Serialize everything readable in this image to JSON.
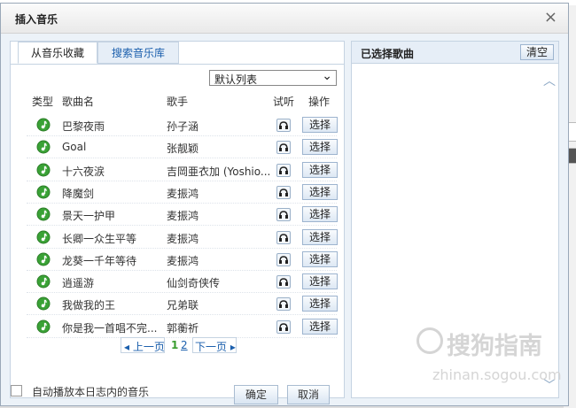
{
  "dialog": {
    "title": "插入音乐",
    "close_glyph": "×"
  },
  "tabs": [
    {
      "label": "从音乐收藏",
      "active": true
    },
    {
      "label": "搜索音乐库",
      "active": false
    }
  ],
  "list_select": {
    "value": "默认列表"
  },
  "columns": {
    "type": "类型",
    "song": "歌曲名",
    "singer": "歌手",
    "listen": "试听",
    "action": "操作"
  },
  "songs": [
    {
      "title": "巴黎夜雨",
      "singer": "孙子涵",
      "action": "选择"
    },
    {
      "title": "Goal",
      "singer": "张靓颖",
      "action": "选择"
    },
    {
      "title": "十六夜涙",
      "singer": "吉岡亜衣加 (Yoshio...",
      "action": "选择"
    },
    {
      "title": "降魔剑",
      "singer": "麦振鸿",
      "action": "选择"
    },
    {
      "title": "景天一护甲",
      "singer": "麦振鸿",
      "action": "选择"
    },
    {
      "title": "长卿一众生平等",
      "singer": "麦振鸿",
      "action": "选择"
    },
    {
      "title": "龙葵一千年等待",
      "singer": "麦振鸿",
      "action": "选择"
    },
    {
      "title": "逍遥游",
      "singer": "仙剑奇侠传",
      "action": "选择"
    },
    {
      "title": "我做我的王",
      "singer": "兄弟联",
      "action": "选择"
    },
    {
      "title": "你是我一首唱不完...",
      "singer": "郭蘅祈",
      "action": "选择"
    }
  ],
  "pager": {
    "prev": "上一页",
    "current": "1",
    "next_page": "2",
    "next": "下一页"
  },
  "footer": {
    "auto_play_label": "自动播放本日志内的音乐",
    "confirm": "确定",
    "cancel": "取消"
  },
  "selected_panel": {
    "title": "已选择歌曲",
    "clear": "清空"
  },
  "watermark": {
    "brand": "搜狗指南",
    "url": "zhinan.sogou.com"
  },
  "icons": {
    "song_type": "music-note-icon",
    "listen": "headphones-icon"
  },
  "colors": {
    "accent_link": "#1b5fad",
    "note_green": "#3aa236",
    "panel_bg": "#ecf2f8",
    "header_bg": "#e6eef7"
  }
}
